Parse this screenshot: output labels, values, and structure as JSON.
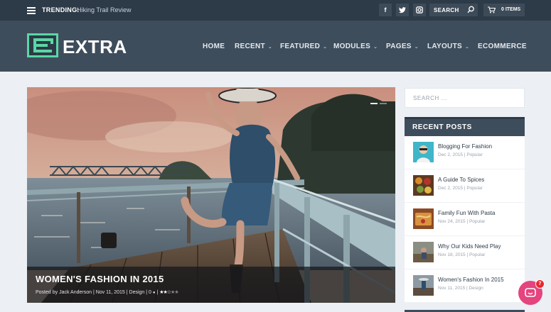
{
  "topbar": {
    "trending_label": "TRENDING:",
    "trending_text": "Hiking Trail Review",
    "social_icons": [
      "facebook-icon",
      "twitter-icon",
      "instagram-icon"
    ],
    "social_glyphs": [
      "f",
      "t",
      "ig"
    ],
    "search_label": "SEARCH",
    "cart_label": "0 ITEMS"
  },
  "header": {
    "logo_text": "EXTRA",
    "nav": [
      {
        "label": "HOME"
      },
      {
        "label": "RECENT",
        "chevron": "⌄"
      },
      {
        "label": "FEATURED",
        "chevron": "⌄"
      },
      {
        "label": "MODULES",
        "chevron": "⌄"
      },
      {
        "label": "PAGES",
        "chevron": "⌄"
      },
      {
        "label": "LAYOUTS",
        "chevron": "⌄"
      },
      {
        "label": "ECOMMERCE"
      }
    ]
  },
  "hero": {
    "title": "WOMEN'S FASHION IN 2015",
    "meta_prefix": "Posted by Jack Anderson | Nov 11, 2015 | Design | 0",
    "comment_glyph": "●",
    "rating_on": "★★☆",
    "rating_off": "★★",
    "rating": 2.5
  },
  "sidebar": {
    "search_placeholder": "SEARCH ...",
    "recent_title": "RECENT POSTS",
    "posts": [
      {
        "title": "Blogging For Fashion",
        "meta": "Dec 2, 2015 | Popular",
        "thumb_color": "#3fb6c9"
      },
      {
        "title": "A Guide To Spices",
        "meta": "Dec 2, 2015 | Popular",
        "thumb_color": "#a5552c"
      },
      {
        "title": "Family Fun With Pasta",
        "meta": "Nov 24, 2015 | Popular",
        "thumb_color": "#b8723a"
      },
      {
        "title": "Why Our Kids Need Play",
        "meta": "Nov 18, 2015 | Popular",
        "thumb_color": "#7d6a55"
      },
      {
        "title": "Women's Fashion In 2015",
        "meta": "Nov 11, 2015 | Design",
        "thumb_color": "#6b7a88"
      }
    ]
  },
  "chat": {
    "badge": "7"
  },
  "colors": {
    "accent": "#5cd6a5",
    "header": "#3e4d5c",
    "topbar": "#2d3a47",
    "chat": "#e5447e"
  }
}
